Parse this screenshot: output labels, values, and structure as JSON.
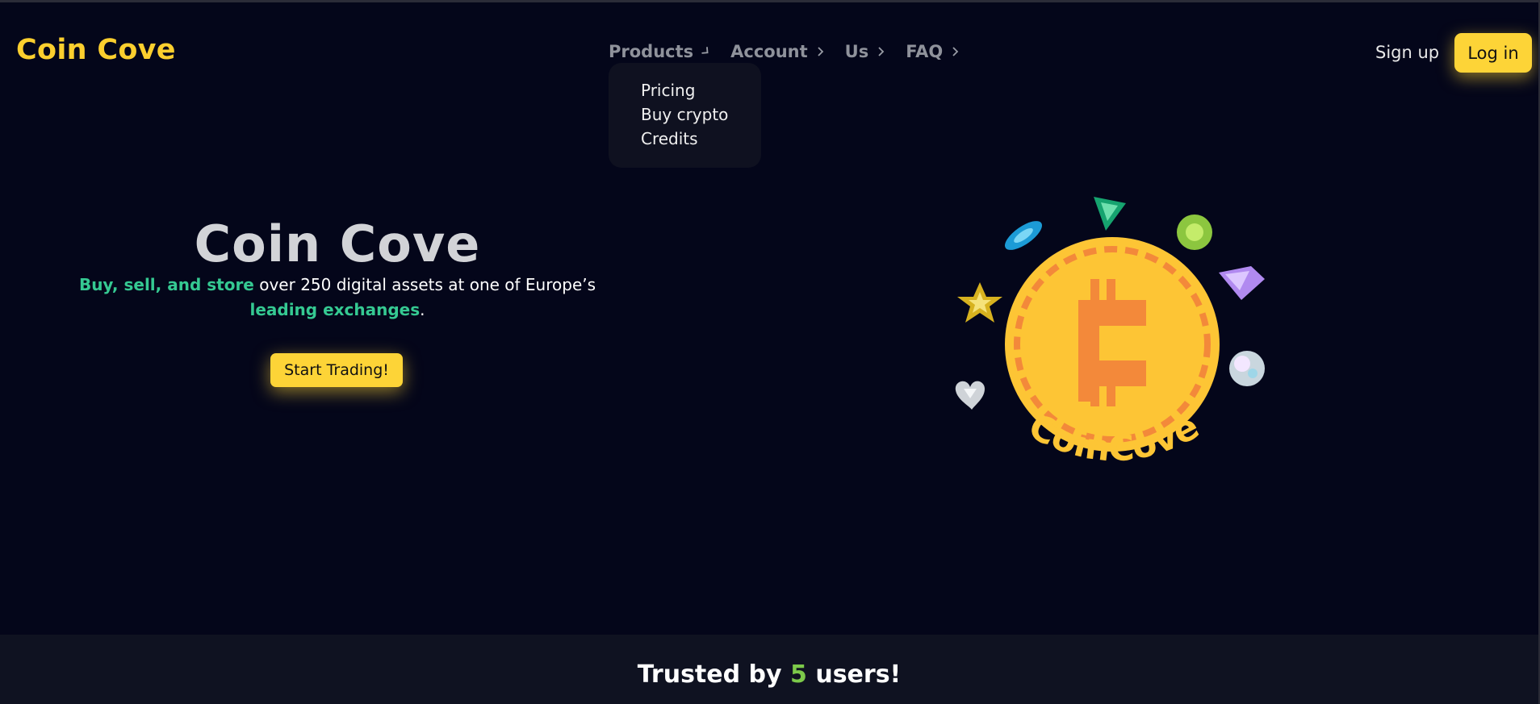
{
  "brand": {
    "name": "Coin Cove",
    "color": "#fccf2e"
  },
  "nav": [
    {
      "label": "Products",
      "icon": "chevron-right-icon"
    },
    {
      "label": "Account",
      "icon": "chevron-right-icon"
    },
    {
      "label": "Us",
      "icon": "chevron-right-icon"
    },
    {
      "label": "FAQ",
      "icon": "chevron-right-icon"
    }
  ],
  "products_dropdown": {
    "items": [
      "Pricing",
      "Buy crypto",
      "Credits"
    ]
  },
  "auth": {
    "signup": "Sign up",
    "login": "Log in",
    "accent": "#fdd437"
  },
  "hero": {
    "title": "Coin Cove",
    "subtitle_parts": [
      {
        "text": "Buy, sell, and store",
        "highlight": true
      },
      {
        "text": " over 250 digital assets at one of Europe’s ",
        "highlight": false
      },
      {
        "text": "leading exchanges",
        "highlight": true
      },
      {
        "text": ".",
        "highlight": false
      }
    ],
    "highlight_color": "#35c992",
    "cta": "Start Trading!",
    "logo_caption": "CoinCove",
    "gem_icons": [
      "marquise-gem-icon",
      "trillion-gem-icon",
      "round-gem-icon",
      "diamond-gem-icon",
      "star-gem-icon",
      "opal-gem-icon",
      "heart-gem-icon"
    ]
  },
  "trust": {
    "prefix": "Trusted by ",
    "count": "5",
    "suffix": " users!",
    "count_color": "#7cc94a"
  }
}
